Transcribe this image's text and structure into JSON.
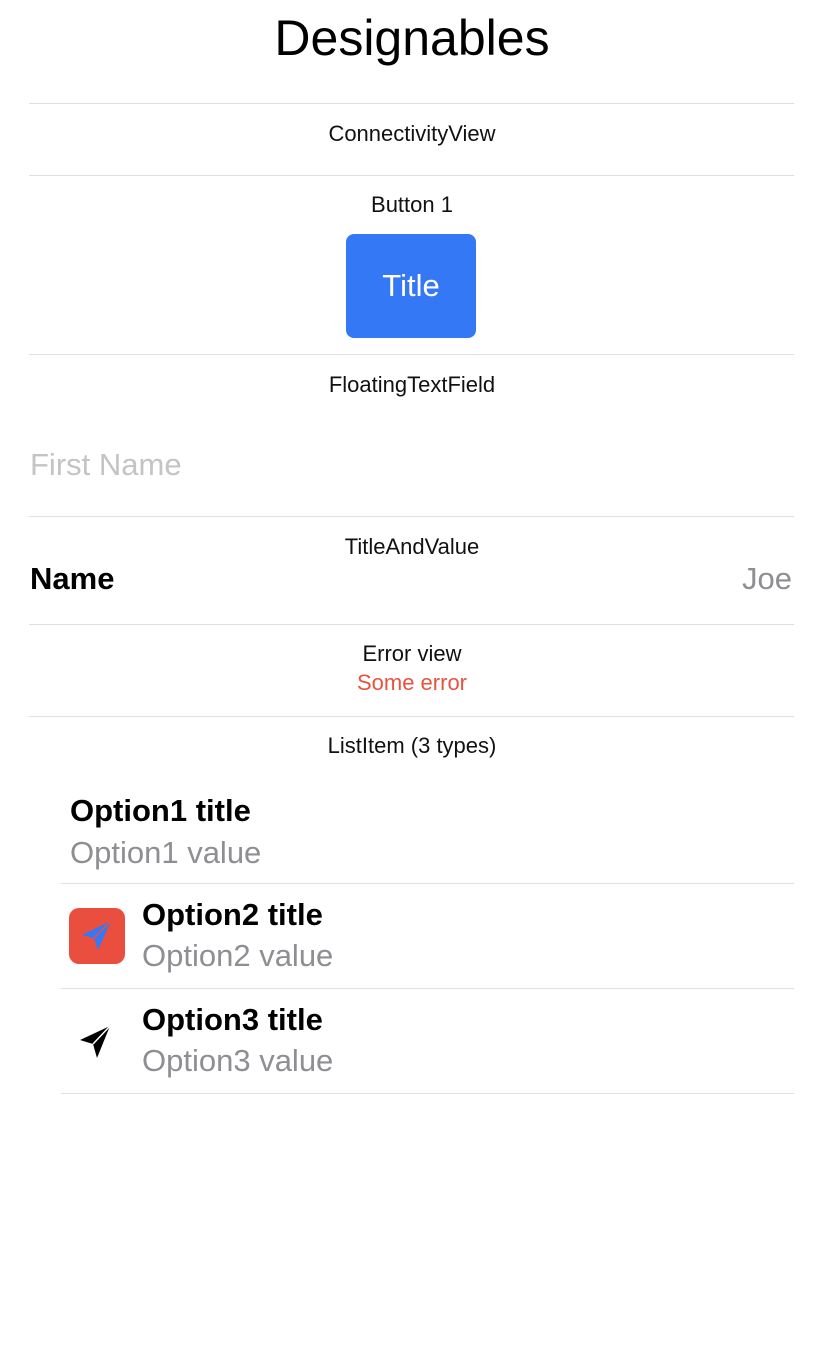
{
  "title": "Designables",
  "sections": {
    "connectivity": {
      "label": "ConnectivityView"
    },
    "button": {
      "label": "Button 1",
      "button_title": "Title"
    },
    "floating_text_field": {
      "label": "FloatingTextField",
      "placeholder": "First Name"
    },
    "title_and_value": {
      "label": "TitleAndValue",
      "title": "Name",
      "value": "Joe"
    },
    "error_view": {
      "label": "Error view",
      "error_text": "Some error"
    },
    "list_item": {
      "label": "ListItem (3 types)",
      "items": [
        {
          "title": "Option1 title",
          "value": "Option1 value",
          "icon": "none"
        },
        {
          "title": "Option2 title",
          "value": "Option2 value",
          "icon": "paper-plane-icon"
        },
        {
          "title": "Option3 title",
          "value": "Option3 value",
          "icon": "paper-plane-icon"
        }
      ]
    }
  },
  "colors": {
    "accent": "#3478f6",
    "error": "#e8533f",
    "secondary_text": "#8e8e93",
    "placeholder": "#c4c4c6",
    "icon_background": "#ea4e3e"
  }
}
